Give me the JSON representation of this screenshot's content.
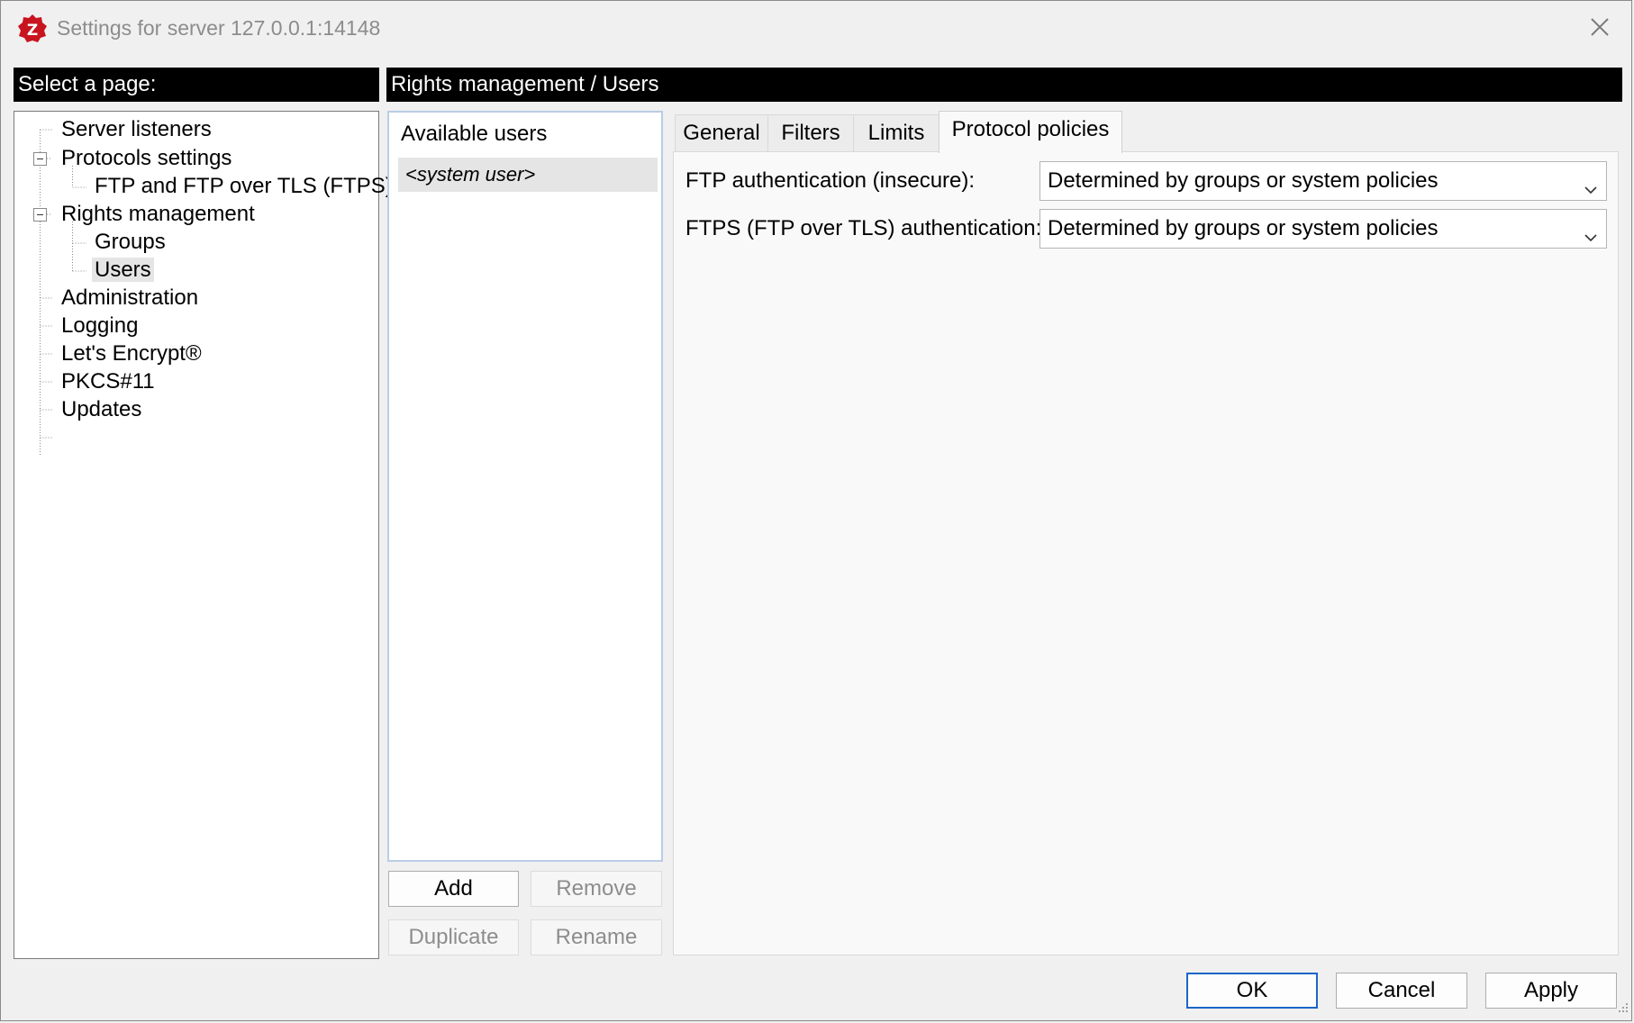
{
  "window": {
    "title": "Settings for server 127.0.0.1:14148",
    "icon": "filezilla-server-icon",
    "close_icon": "close-icon",
    "accent_color": "#1a66c8",
    "icon_color": "#c8141e"
  },
  "left_header": {
    "label": "Select a page:"
  },
  "right_header": {
    "label": "Rights management / Users"
  },
  "tree": {
    "items": [
      {
        "label": "Server listeners",
        "level": 0
      },
      {
        "label": "Protocols settings",
        "level": 0,
        "expanded": true
      },
      {
        "label": "FTP and FTP over TLS (FTPS)",
        "level": 1
      },
      {
        "label": "Rights management",
        "level": 0,
        "expanded": true
      },
      {
        "label": "Groups",
        "level": 1
      },
      {
        "label": "Users",
        "level": 1,
        "selected": true
      },
      {
        "label": "Administration",
        "level": 0
      },
      {
        "label": "Logging",
        "level": 0
      },
      {
        "label": "Let's Encrypt®",
        "level": 0
      },
      {
        "label": "PKCS#11",
        "level": 0
      },
      {
        "label": "Updates",
        "level": 0
      }
    ]
  },
  "users": {
    "caption": "Available users",
    "items": [
      "<system user>"
    ],
    "buttons": {
      "add": "Add",
      "remove": "Remove",
      "duplicate": "Duplicate",
      "rename": "Rename"
    }
  },
  "tabs": [
    {
      "label": "General"
    },
    {
      "label": "Filters"
    },
    {
      "label": "Limits"
    },
    {
      "label": "Protocol policies",
      "active": true
    }
  ],
  "protocol_policies": {
    "ftp_auth": {
      "label": "FTP authentication (insecure):",
      "value": "Determined by groups or system policies"
    },
    "ftps_auth": {
      "label": "FTPS (FTP over TLS) authentication:",
      "value": "Determined by groups or system policies"
    }
  },
  "footer": {
    "ok": "OK",
    "cancel": "Cancel",
    "apply": "Apply"
  }
}
